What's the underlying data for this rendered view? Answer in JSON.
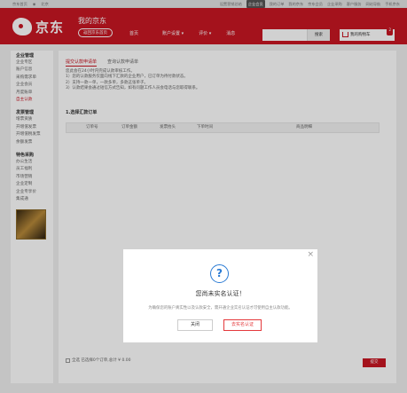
{
  "topbar": {
    "home": "京东首页",
    "location": "北京",
    "right": [
      {
        "label": "设置营销总结"
      },
      {
        "label": "企业会员",
        "highlight": true
      },
      {
        "label": "我的订单"
      },
      {
        "label": "我的京东"
      },
      {
        "label": "京东会员"
      },
      {
        "label": "企业采购"
      },
      {
        "label": "客户服务"
      },
      {
        "label": "网站导航"
      },
      {
        "label": "手机京东"
      }
    ]
  },
  "header": {
    "brand": "京东",
    "title": "我的京东",
    "back_home": "返回京东首页",
    "nav": [
      "首页",
      "账户设置 ▾",
      "评价 ▾",
      "消息"
    ],
    "search_button": "搜索",
    "cart_label": "我的购物车",
    "cart_count": "2"
  },
  "sidebar": {
    "groups": [
      {
        "title": "企业管理",
        "items": [
          "企业专区",
          "账户信息",
          "采购需求单",
          "企业会员",
          "月度账单",
          "自主认款"
        ]
      },
      {
        "title": "发票管理",
        "items": [
          "增票资质",
          "开增值发票",
          "开增值税发票",
          "余额发票"
        ]
      },
      {
        "title": "特色采购",
        "items": [
          "办公生活",
          "员工福利",
          "市场营销",
          "企业定制",
          "企业专享价",
          "集成通"
        ]
      }
    ],
    "active_item": "自主认款"
  },
  "main": {
    "tabs": [
      "提交认款申请单",
      "查询认款申请单"
    ],
    "desc": [
      "您此会在24小时内完成认款审核工作。",
      "1）您的认款服务仅面向线下汇款的企业用户，已订单为待付款状态。",
      "2）支持一款一单，一款多单，多款这张单子。",
      "3）认款结果会通过短信方式告知，如有问题工作人员会电话与您取得联系。"
    ],
    "section_title": "1.选择汇款订单",
    "columns": [
      "订单号",
      "订单金额",
      "发票抬头",
      "下单时间",
      "商品明细"
    ],
    "footer_text": "全选  已选择0个订单,总计 ¥ 0.00",
    "submit": "提交"
  },
  "modal": {
    "title": "您尚未实名认证！",
    "desc": "为确保您的账户真实性以及认款安全，需开通企业实名认证才可使用自主认款功能。",
    "cancel": "关闭",
    "confirm": "去实名认证"
  },
  "colors": {
    "accent": "#c81623",
    "info": "#2a7bd4"
  }
}
